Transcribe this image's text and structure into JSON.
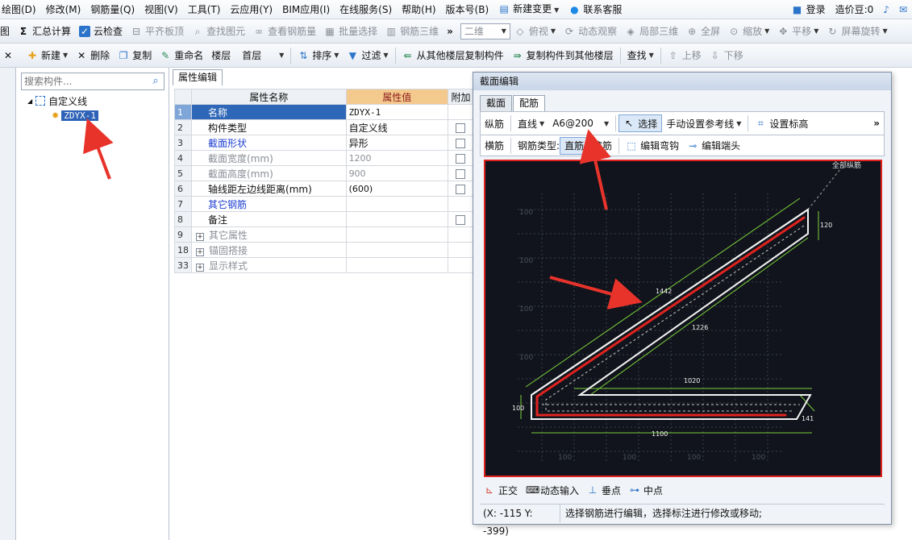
{
  "menubar": {
    "items": [
      "绘图(D)",
      "修改(M)",
      "钢筋量(Q)",
      "视图(V)",
      "工具(T)",
      "云应用(Y)",
      "BIM应用(I)",
      "在线服务(S)",
      "帮助(H)",
      "版本号(B)",
      "新建变更",
      "联系客服"
    ],
    "login": "登录",
    "coins": "造价豆:0"
  },
  "toolbar1": {
    "items": [
      "图",
      "汇总计算",
      "云检查",
      "平齐板顶",
      "查找图元",
      "查看钢筋量",
      "批量选择",
      "钢筋三维",
      "二维",
      "俯视",
      "动态观察",
      "局部三维",
      "全屏",
      "缩放",
      "平移",
      "屏幕旋转"
    ]
  },
  "toolbar2": {
    "new": "新建",
    "delete": "删除",
    "copy": "复制",
    "rename": "重命名",
    "floor_label": "楼层",
    "floor_value": "首层",
    "sort": "排序",
    "filter": "过滤",
    "copy_from_other": "从其他楼层复制构件",
    "copy_to_other": "复制构件到其他楼层",
    "find": "查找",
    "move_up": "上移",
    "move_down": "下移"
  },
  "left_panel": {
    "search_placeholder": "搜索构件...",
    "tree_root": "自定义线",
    "tree_child": "ZDYX-1"
  },
  "property_editor": {
    "tab": "属性编辑",
    "headers": [
      "属性名称",
      "属性值",
      "附加"
    ],
    "rows": [
      {
        "num": "1",
        "name": "名称",
        "value": "ZDYX-1",
        "checkbox": false
      },
      {
        "num": "2",
        "name": "构件类型",
        "value": "自定义线",
        "checkbox": true
      },
      {
        "num": "3",
        "name": "截面形状",
        "value": "异形",
        "checkbox": true
      },
      {
        "num": "4",
        "name": "截面宽度(mm)",
        "value": "1200",
        "checkbox": true
      },
      {
        "num": "5",
        "name": "截面高度(mm)",
        "value": "900",
        "checkbox": true
      },
      {
        "num": "6",
        "name": "轴线距左边线距离(mm)",
        "value": "(600)",
        "checkbox": true
      },
      {
        "num": "7",
        "name": "其它钢筋",
        "value": "",
        "checkbox": false
      },
      {
        "num": "8",
        "name": "备注",
        "value": "",
        "checkbox": true
      },
      {
        "num": "9",
        "name": "其它属性",
        "value": "",
        "checkbox": false
      },
      {
        "num": "18",
        "name": "锚固搭接",
        "value": "",
        "checkbox": false
      },
      {
        "num": "33",
        "name": "显示样式",
        "value": "",
        "checkbox": false
      }
    ]
  },
  "dialog": {
    "title": "截面编辑",
    "tabs": [
      "截面",
      "配筋"
    ],
    "toolbar1": {
      "longitudinal": "纵筋",
      "line_type": "直线",
      "rebar_spec": "A6@200",
      "select": "选择",
      "manual_ref": "手动设置参考线",
      "set_elevation": "设置标高"
    },
    "toolbar2": {
      "transverse": "横筋",
      "rebar_type_label": "钢筋类型:",
      "straight": "直筋",
      "stirrup": "箍筋",
      "edit_hook": "编辑弯钩",
      "edit_end": "编辑端头"
    },
    "canvas": {
      "label_all_rebar": "全部纵筋",
      "dim_1442": "1442",
      "dim_1226": "1226",
      "dim_1020": "1020",
      "dim_1100": "1100",
      "dim_120": "120",
      "dim_100": "100",
      "dim_141": "141",
      "grid_label": "100"
    },
    "bottom": {
      "ortho": "正交",
      "dynamic_input": "动态输入",
      "perpendicular": "垂点",
      "midpoint": "中点"
    },
    "status": {
      "coord": "(X: -115 Y: -399)",
      "message": "选择钢筋进行编辑，选择标注进行修改或移动;"
    }
  },
  "colors": {
    "highlight_red": "#e0231f",
    "selection_blue": "#2f67b8",
    "header_orange": "#f4c98d",
    "canvas_bg": "#11141c",
    "dim_green": "#7cd13c"
  }
}
